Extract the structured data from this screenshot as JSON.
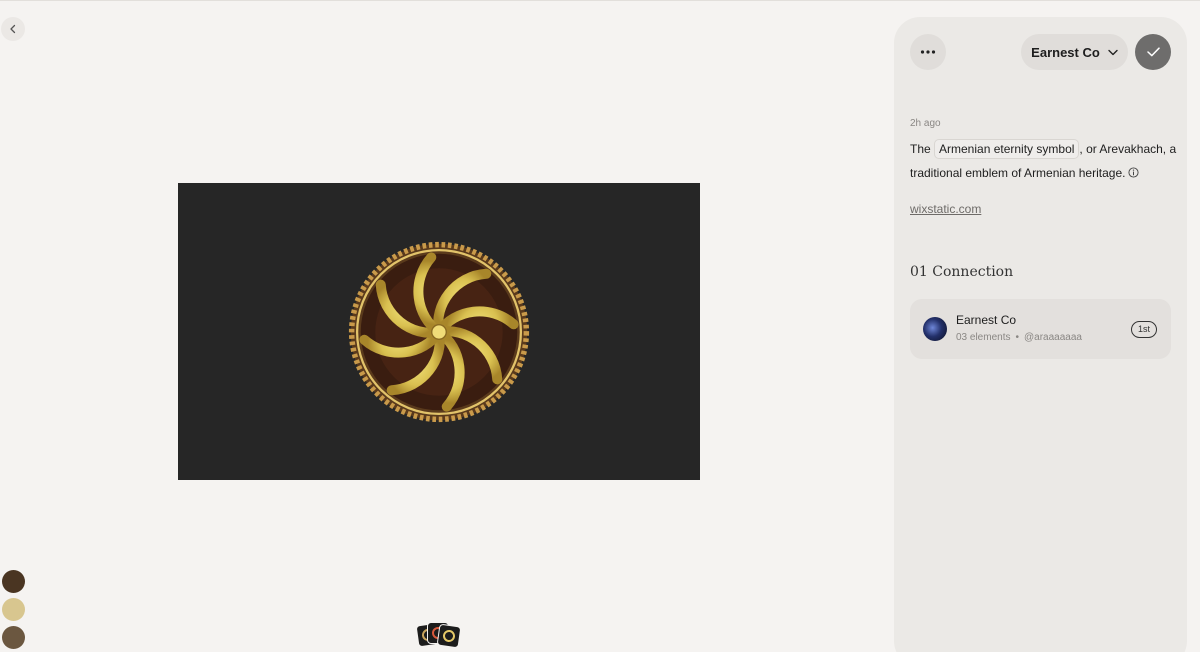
{
  "toolbar": {
    "back_icon": "chevron-left-icon",
    "more_icon": "ellipsis-icon",
    "owner_label": "Earnest Co",
    "owner_dropdown_icon": "chevron-down-icon",
    "confirm_icon": "check-icon"
  },
  "image": {
    "subject": "arevakhach-medallion",
    "background": "#262626"
  },
  "palette": [
    "#4a3522",
    "#d8c68f",
    "#6b5740"
  ],
  "details": {
    "timestamp": "2h ago",
    "description_before": "The ",
    "description_chip": "Armenian eternity symbol",
    "description_after": ", or Arevakhach, a traditional emblem of Armenian heritage.",
    "info_icon": "info-icon",
    "source": "wixstatic.com"
  },
  "connections": {
    "title": "01 Connection",
    "items": [
      {
        "name": "Earnest Co",
        "elements": "03 elements",
        "separator": "•",
        "handle": "@araaaaaaa",
        "degree": "1st"
      }
    ]
  }
}
